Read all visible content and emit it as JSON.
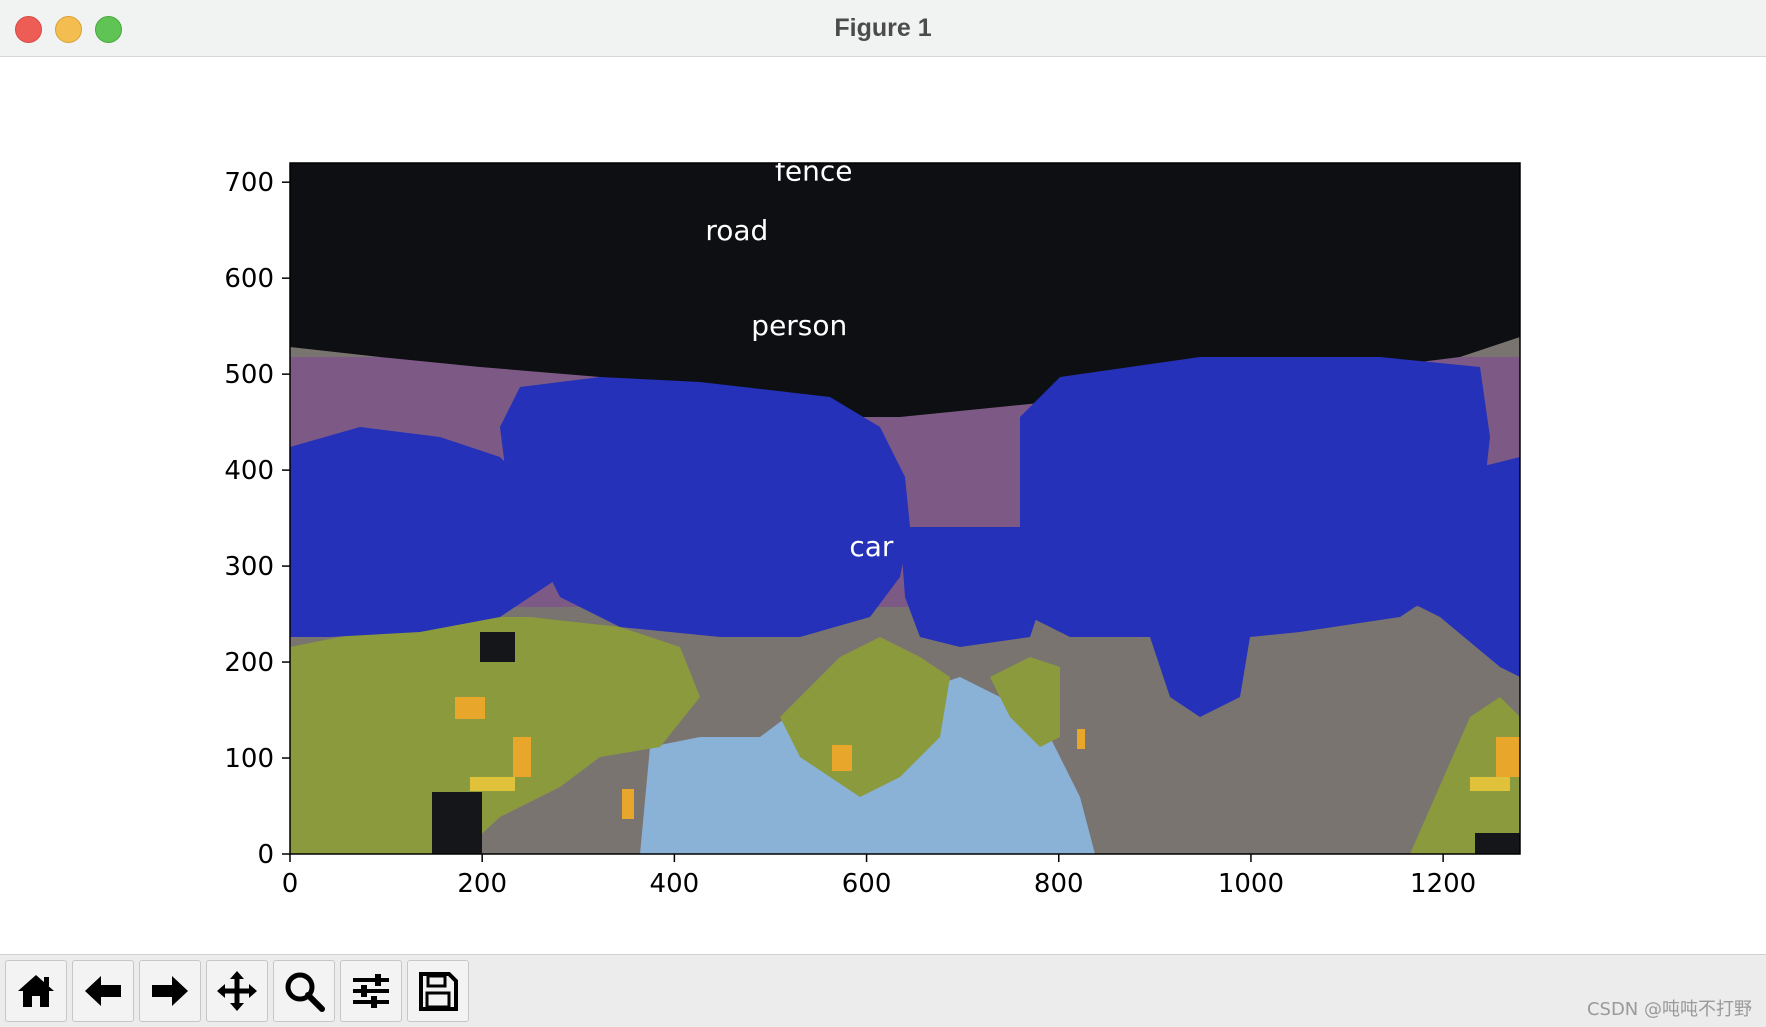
{
  "window": {
    "title": "Figure 1"
  },
  "chart_data": {
    "type": "image",
    "xlim": [
      0,
      1280
    ],
    "ylim": [
      0,
      720
    ],
    "xticks": [
      "0",
      "200",
      "400",
      "600",
      "800",
      "1000",
      "1200"
    ],
    "yticks": [
      "0",
      "100",
      "200",
      "300",
      "400",
      "500",
      "600",
      "700"
    ],
    "annotations": [
      {
        "text": "fence",
        "x": 545,
        "y": 712
      },
      {
        "text": "road",
        "x": 465,
        "y": 650
      },
      {
        "text": "person",
        "x": 530,
        "y": 551
      },
      {
        "text": "car",
        "x": 605,
        "y": 321
      }
    ],
    "segment_colors": {
      "car": "#2431b8",
      "sky": "#8ab1d6",
      "vegetation": "#8a9a3c",
      "building": "#7a7470",
      "background_purple": "#7d5a86",
      "dark_top": "#0e0f12",
      "traffic_light": "#e8a72a"
    }
  },
  "toolbar": {
    "buttons": [
      {
        "icon": "home-icon",
        "name": "home-button"
      },
      {
        "icon": "arrow-left-icon",
        "name": "back-button"
      },
      {
        "icon": "arrow-right-icon",
        "name": "forward-button"
      },
      {
        "icon": "move-icon",
        "name": "pan-button"
      },
      {
        "icon": "search-icon",
        "name": "zoom-button"
      },
      {
        "icon": "sliders-icon",
        "name": "configure-subplots-button"
      },
      {
        "icon": "save-icon",
        "name": "save-button"
      }
    ]
  },
  "watermark": "CSDN @吨吨不打野"
}
